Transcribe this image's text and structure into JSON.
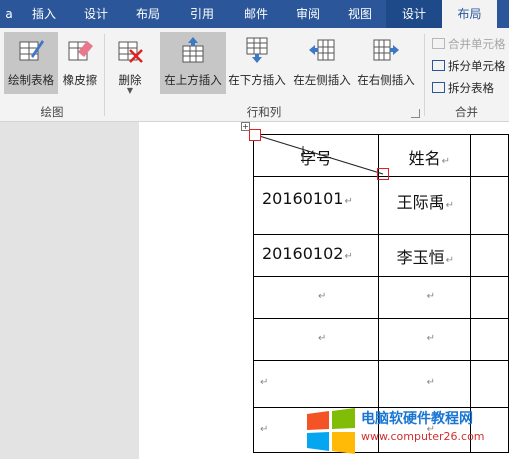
{
  "tabs": [
    {
      "label": "a"
    },
    {
      "label": "插入"
    },
    {
      "label": "设计"
    },
    {
      "label": "布局"
    },
    {
      "label": "引用"
    },
    {
      "label": "邮件"
    },
    {
      "label": "审阅"
    },
    {
      "label": "视图"
    },
    {
      "label": "设计"
    },
    {
      "label": "布局"
    }
  ],
  "ribbon": {
    "draw_table": "绘制表格",
    "eraser": "橡皮擦",
    "delete": "删除",
    "insert_above": "在上方插入",
    "insert_below": "在下方插入",
    "insert_left": "在左侧插入",
    "insert_right": "在右侧插入",
    "merge_cells": "合并单元格",
    "split_cells": "拆分单元格",
    "split_table": "拆分表格",
    "group_draw": "绘图",
    "group_rows_cols": "行和列",
    "group_merge": "合并"
  },
  "table": {
    "headers": [
      "学号",
      "姓名"
    ],
    "rows": [
      [
        "20160101",
        "王际禹"
      ],
      [
        "20160102",
        "李玉恒"
      ],
      [
        "",
        ""
      ],
      [
        "",
        ""
      ],
      [
        "",
        ""
      ],
      [
        "",
        ""
      ]
    ],
    "paragraph_mark": "↵"
  },
  "watermark": {
    "line1": "电脑软硬件教程网",
    "line2": "www.computer26.com"
  },
  "colors": {
    "tabbar": "#2b579a",
    "ribbon": "#f3f3f3",
    "handle": "#d22222"
  }
}
